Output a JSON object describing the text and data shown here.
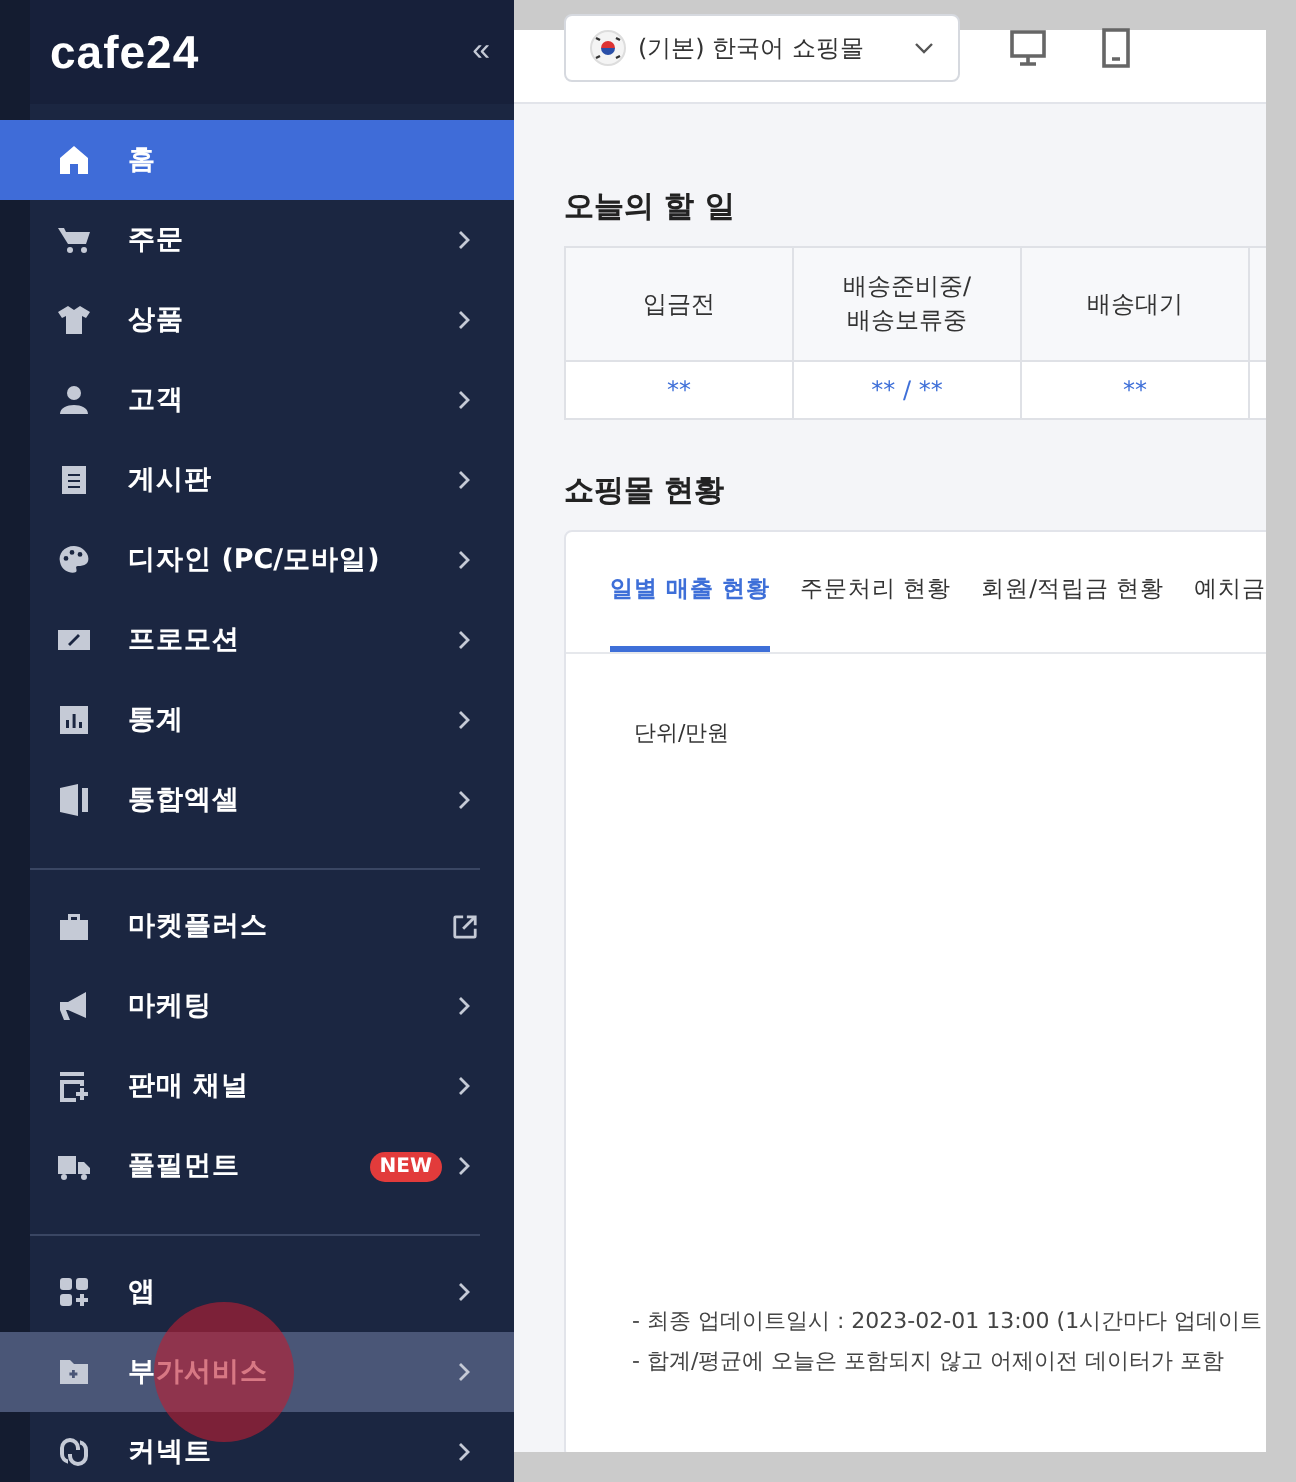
{
  "sidebar": {
    "logo": "cafe24",
    "collapse": "«",
    "groups": [
      [
        {
          "label": "홈",
          "kind": "plain",
          "selected": true,
          "hovered": false,
          "clicked": false
        },
        {
          "label": "주문",
          "kind": "submenu",
          "selected": false,
          "hovered": false,
          "clicked": false
        },
        {
          "label": "상품",
          "kind": "submenu",
          "selected": false,
          "hovered": false,
          "clicked": false
        },
        {
          "label": "고객",
          "kind": "submenu",
          "selected": false,
          "hovered": false,
          "clicked": false
        },
        {
          "label": "게시판",
          "kind": "submenu",
          "selected": false,
          "hovered": false,
          "clicked": false
        },
        {
          "label": "디자인 (PC/모바일)",
          "kind": "submenu",
          "selected": false,
          "hovered": false,
          "clicked": false
        },
        {
          "label": "프로모션",
          "kind": "submenu",
          "selected": false,
          "hovered": false,
          "clicked": false
        },
        {
          "label": "통계",
          "kind": "submenu",
          "selected": false,
          "hovered": false,
          "clicked": false
        },
        {
          "label": "통합엑셀",
          "kind": "submenu",
          "selected": false,
          "hovered": false,
          "clicked": false
        }
      ],
      [
        {
          "label": "마켓플러스",
          "kind": "external",
          "selected": false,
          "hovered": false,
          "clicked": false
        },
        {
          "label": "마케팅",
          "kind": "submenu",
          "selected": false,
          "hovered": false,
          "clicked": false
        },
        {
          "label": "판매 채널",
          "kind": "submenu",
          "selected": false,
          "hovered": false,
          "clicked": false
        },
        {
          "label": "풀필먼트",
          "kind": "submenu",
          "badge": "NEW",
          "selected": false,
          "hovered": false,
          "clicked": false
        }
      ],
      [
        {
          "label": "앱",
          "kind": "submenu",
          "selected": false,
          "hovered": false,
          "clicked": false
        },
        {
          "label": "부가서비스",
          "kind": "submenu",
          "selected": false,
          "hovered": true,
          "clicked": true
        },
        {
          "label": "커넥트",
          "kind": "submenu",
          "selected": false,
          "hovered": false,
          "clicked": false
        }
      ]
    ]
  },
  "header": {
    "store_select": {
      "value": "(기본) 한국어 쇼핑몰"
    }
  },
  "todo": {
    "title": "오늘의 할 일",
    "columns": [
      {
        "label": "입금전",
        "value": "**"
      },
      {
        "label": "배송준비중/\n배송보류중",
        "value": "** / **"
      },
      {
        "label": "배송대기",
        "value": "**"
      },
      {}
    ]
  },
  "status": {
    "title": "쇼핑몰 현황",
    "tabs": [
      {
        "label": "일별 매출 현황",
        "selected": true
      },
      {
        "label": "주문처리 현황",
        "selected": false
      },
      {
        "label": "회원/적립금 현황",
        "selected": false
      },
      {
        "label": "예치금",
        "selected": false
      }
    ],
    "unit": "단위/만원",
    "notes": [
      "- 최종 업데이트일시 : 2023-02-01 13:00 (1시간마다 업데이트",
      "- 합계/평균에 오늘은 포함되지 않고 어제이전 데이터가 포함"
    ]
  }
}
